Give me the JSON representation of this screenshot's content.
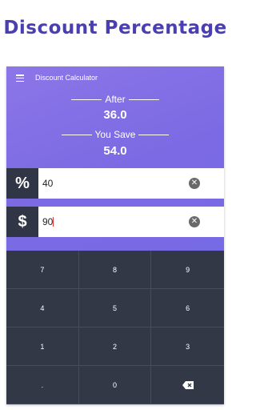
{
  "promo": {
    "title": "Discount Percentage"
  },
  "appbar": {
    "title": "Discount Calculator"
  },
  "results": {
    "after_label": "After",
    "after_value": "36.0",
    "save_label": "You Save",
    "save_value": "54.0"
  },
  "inputs": {
    "percent_symbol": "%",
    "percent_value": "40",
    "price_symbol": "$",
    "price_value": "90"
  },
  "keypad": {
    "keys": [
      "7",
      "8",
      "9",
      "4",
      "5",
      "6",
      "1",
      "2",
      "3",
      ".",
      "0",
      "backspace"
    ]
  },
  "colors": {
    "accent": "#4a3fb2",
    "hero_start": "#8c76e8",
    "hero_end": "#786ae4",
    "dark": "#323846"
  },
  "icons": [
    "menu-icon",
    "clear-icon",
    "backspace-icon"
  ]
}
